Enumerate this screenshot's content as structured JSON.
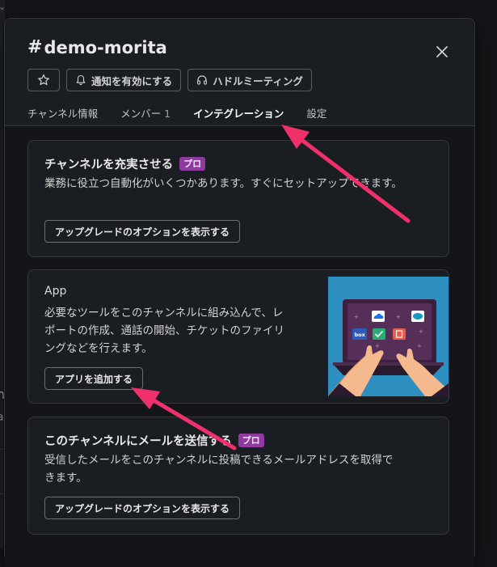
{
  "background": {
    "frag1": "n",
    "frag2": "a"
  },
  "modal": {
    "title_hash": "#",
    "title": "demo-morita",
    "actions": {
      "notify_label": "通知を有効にする",
      "huddle_label": "ハドルミーティング"
    },
    "tabs": [
      {
        "label": "チャンネル情報"
      },
      {
        "label": "メンバー",
        "count": "1"
      },
      {
        "label": "インテグレーション"
      },
      {
        "label": "設定"
      }
    ]
  },
  "cards": {
    "enrich": {
      "title": "チャンネルを充実させる",
      "badge": "プロ",
      "desc": "業務に役立つ自動化がいくつかあります。すぐにセットアップできます。",
      "button": "アップグレードのオプションを表示する"
    },
    "app": {
      "title": "App",
      "desc_line1": "必要なツールをこのチャンネルに組み込んで、レ",
      "desc_line2": "ポートの作成、通話の開始、チケットのファイリ",
      "desc_line3": "ングなどを行えます。",
      "button": "アプリを追加する",
      "illus_box_label": "box"
    },
    "email": {
      "title": "このチャンネルにメールを送信する",
      "badge": "プロ",
      "desc_line1": "受信したメールをこのチャンネルに投稿できるメールアドレスを取得で",
      "desc_line2": "きます。",
      "button": "アップグレードのオプションを表示する"
    }
  },
  "colors": {
    "tab_underline": "#1d9bd1",
    "pro_badge": "#8e3ba0",
    "annotation_arrow": "#f0306b",
    "illustration_bg": "#2d8fbf"
  }
}
